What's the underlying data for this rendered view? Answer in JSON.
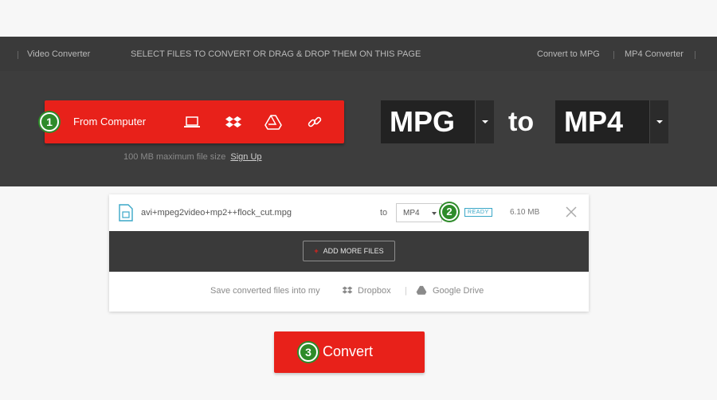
{
  "topbar": {
    "logo": "Video Converter",
    "instruction": "SELECT FILES TO CONVERT OR DRAG & DROP THEM ON THIS PAGE",
    "links": [
      "Convert to MPG",
      "MP4 Converter"
    ]
  },
  "upload": {
    "step": "1",
    "label": "From Computer",
    "sources": [
      "laptop-icon",
      "dropbox-icon",
      "google-drive-icon",
      "link-icon"
    ],
    "limit": "100 MB maximum file size",
    "signup": "Sign Up"
  },
  "formats": {
    "from": "MPG",
    "to_word": "to",
    "to": "MP4"
  },
  "file": {
    "name": "avi+mpeg2video+mp2++flock_cut.mpg",
    "to_label": "to",
    "target": "MP4",
    "step": "2",
    "status": "READY",
    "size": "6.10 MB"
  },
  "add_more": "ADD MORE FILES",
  "save": {
    "label": "Save converted files into my",
    "dropbox": "Dropbox",
    "drive": "Google Drive"
  },
  "convert": {
    "step": "3",
    "label": "Convert"
  },
  "colors": {
    "accent": "#e8211a",
    "step_badge": "#2e8b2a",
    "dark_bg": "#3d3d3d",
    "ready": "#3aa7c7"
  }
}
